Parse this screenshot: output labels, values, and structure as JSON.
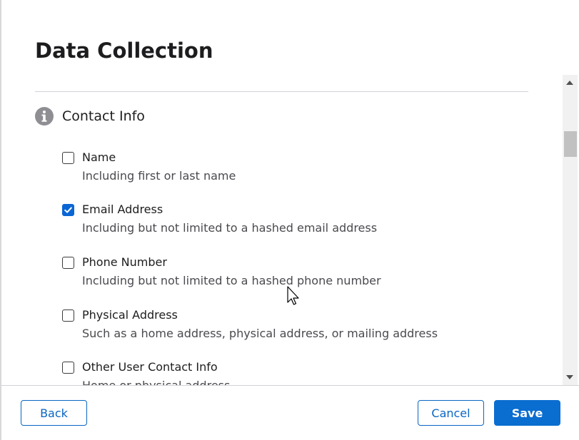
{
  "modal": {
    "title": "Data Collection"
  },
  "section": {
    "label": "Contact Info",
    "icon": "info-icon"
  },
  "options": [
    {
      "label": "Name",
      "description": "Including first or last name",
      "checked": false
    },
    {
      "label": "Email Address",
      "description": "Including but not limited to a hashed email address",
      "checked": true
    },
    {
      "label": "Phone Number",
      "description": "Including but not limited to a hashed phone number",
      "checked": false
    },
    {
      "label": "Physical Address",
      "description": "Such as a home address, physical address, or mailing address",
      "checked": false
    },
    {
      "label": "Other User Contact Info",
      "description": "Home or physical address",
      "checked": false
    }
  ],
  "footer": {
    "back_label": "Back",
    "cancel_label": "Cancel",
    "save_label": "Save"
  },
  "colors": {
    "accent": "#0a6dd0",
    "checkbox_checked": "#0a66d4",
    "divider": "#d2d2d7",
    "icon_gray": "#8e8e93"
  }
}
